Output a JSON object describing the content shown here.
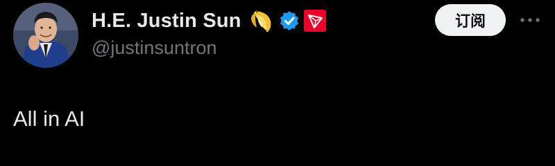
{
  "author": {
    "display_name": "H.E. Justin Sun",
    "handle": "@justinsuntron",
    "name_emoji_icon": "banana-icon",
    "verified_icon": "verified-badge-icon",
    "affiliate_icon": "tron-logo-icon"
  },
  "actions": {
    "subscribe_label": "订阅",
    "more_icon": "more-horizontal-icon"
  },
  "tweet": {
    "text": "All in AI"
  },
  "colors": {
    "background": "#000000",
    "primary_text": "#e7e9ea",
    "secondary_text": "#71767b",
    "verified_blue": "#1d9bf0",
    "tron_red": "#eb0029",
    "subscribe_bg": "#eff3f4"
  }
}
